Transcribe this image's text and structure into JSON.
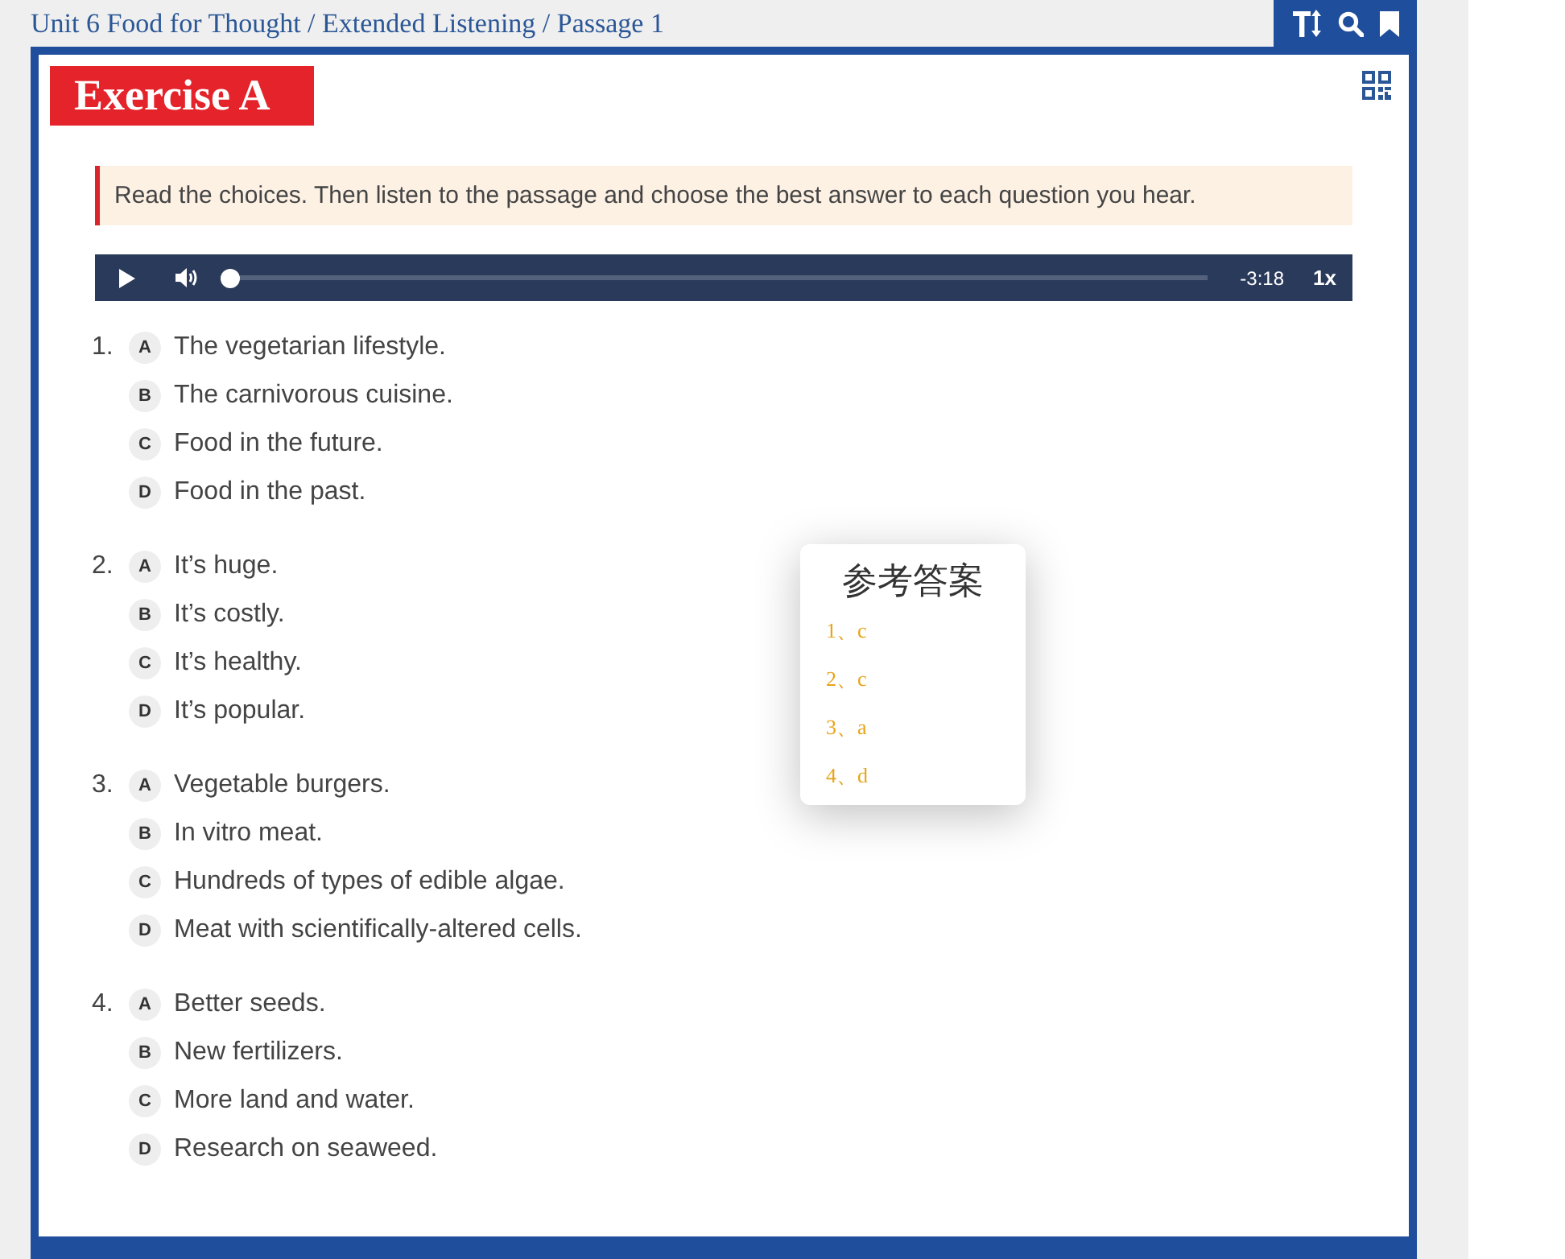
{
  "breadcrumb": "Unit 6 Food for Thought / Extended Listening / Passage 1",
  "exercise": {
    "title": "Exercise A",
    "instruction": "Read the choices. Then listen to the passage and choose the best answer to each question you hear."
  },
  "audio_player": {
    "playing": false,
    "level": 0,
    "time": "-3:18",
    "speed": "1x"
  },
  "questions": [
    {
      "number": "1.",
      "options": [
        {
          "letter": "A",
          "text": "The vegetarian lifestyle.",
          "selected": false
        },
        {
          "letter": "B",
          "text": "The carnivorous cuisine.",
          "selected": false
        },
        {
          "letter": "C",
          "text": "Food in the future.",
          "selected": false
        },
        {
          "letter": "D",
          "text": "Food in the past.",
          "selected": false
        }
      ]
    },
    {
      "number": "2.",
      "options": [
        {
          "letter": "A",
          "text": "It’s huge.",
          "selected": false
        },
        {
          "letter": "B",
          "text": "It’s costly.",
          "selected": false
        },
        {
          "letter": "C",
          "text": "It’s healthy.",
          "selected": false
        },
        {
          "letter": "D",
          "text": "It’s popular.",
          "selected": false
        }
      ]
    },
    {
      "number": "3.",
      "options": [
        {
          "letter": "A",
          "text": "Vegetable burgers.",
          "selected": false
        },
        {
          "letter": "B",
          "text": "In vitro meat.",
          "selected": false
        },
        {
          "letter": "C",
          "text": "Hundreds of types of edible algae.",
          "selected": false
        },
        {
          "letter": "D",
          "text": "Meat with scientifically-altered cells.",
          "selected": false
        }
      ]
    },
    {
      "number": "4.",
      "options": [
        {
          "letter": "A",
          "text": "Better seeds.",
          "selected": false
        },
        {
          "letter": "B",
          "text": "New fertilizers.",
          "selected": false
        },
        {
          "letter": "C",
          "text": "More land and water.",
          "selected": false
        },
        {
          "letter": "D",
          "text": "Research on seaweed.",
          "selected": false
        }
      ]
    }
  ],
  "answer_popup": {
    "title": "参考答案",
    "answers": [
      "1、c",
      "2、c",
      "3、a",
      "4、d"
    ]
  }
}
